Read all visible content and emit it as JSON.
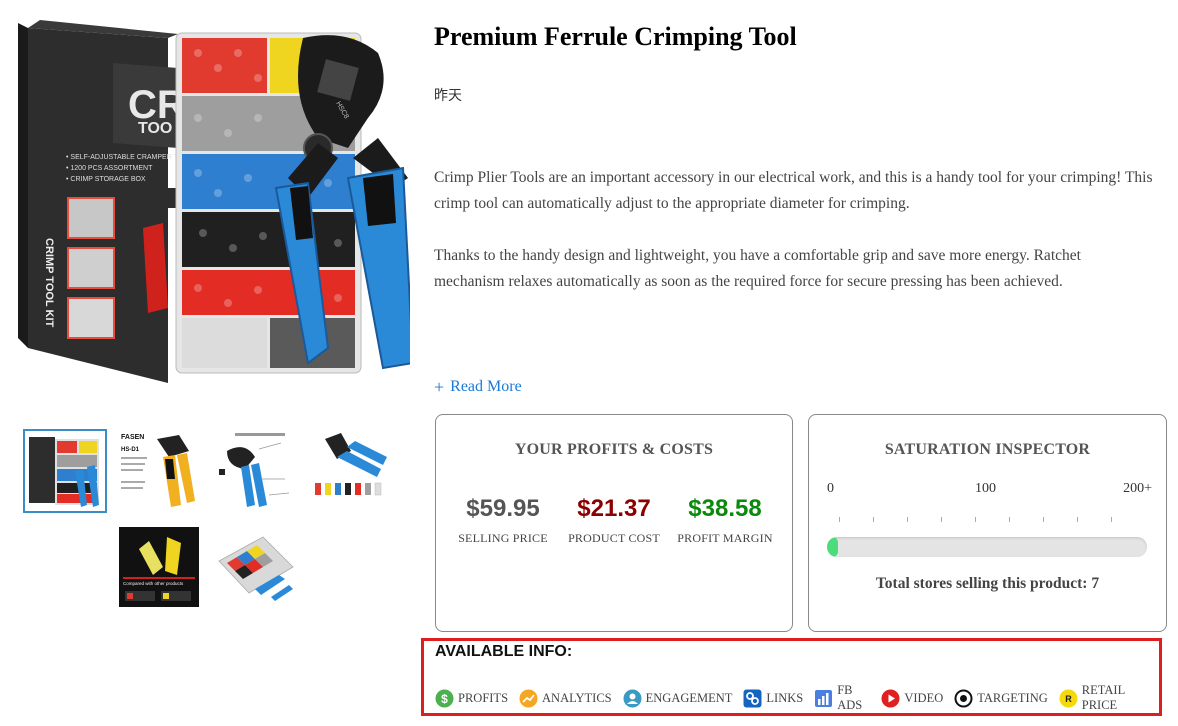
{
  "product": {
    "title": "Premium Ferrule Crimping Tool",
    "date": "昨天",
    "description": [
      "Crimp Plier Tools are an important accessory in our electrical work, and this is a handy tool for your crimping! This crimp tool can automatically adjust to the appropriate diameter for crimping.",
      "Thanks to the handy design and lightweight, you have a comfortable grip and save more energy. Ratchet mechanism relaxes automatically as soon as the required force for secure pressing has been achieved."
    ],
    "read_more": "Read More",
    "main_image": {
      "box_brand": "CRI",
      "box_brand2": "TOO",
      "box_side": "CRIMP TOOL KIT",
      "box_features": [
        "• SELF-ADJUSTABLE CRAMPER TOOL",
        "• 1200 PCS ASSORTMENT",
        "• CRIMP STORAGE BOX"
      ],
      "tool_label": "HSC8"
    },
    "thumbnails": [
      {
        "name": "kit-box-thumbnail",
        "text": ""
      },
      {
        "name": "wire-stripper-thumbnail",
        "text": "FASEN",
        "text2": "HS-D1"
      },
      {
        "name": "crimper-diagram-thumbnail",
        "text": ""
      },
      {
        "name": "ferrule-colors-thumbnail",
        "text": ""
      },
      {
        "name": "wire-connector-thumbnail",
        "text": "Compared with other products"
      },
      {
        "name": "ferrule-box-thumbnail",
        "text": ""
      }
    ]
  },
  "profits": {
    "title": "YOUR PROFITS & COSTS",
    "selling_price": {
      "value": "$59.95",
      "label": "SELLING PRICE",
      "color": "#555555"
    },
    "product_cost": {
      "value": "$21.37",
      "label": "PRODUCT COST",
      "color": "#8b0000"
    },
    "profit_margin": {
      "value": "$38.58",
      "label": "PROFIT MARGIN",
      "color": "#0a8a0a"
    }
  },
  "saturation": {
    "title": "SATURATION INSPECTOR",
    "scale": [
      "0",
      "100",
      "200+"
    ],
    "fill_fraction": 0.035,
    "fill_color": "#4cdc7c",
    "stores_text": "Total stores selling this product: 7"
  },
  "available_info": {
    "title": "AVAILABLE INFO:",
    "items": [
      {
        "label": "PROFITS",
        "icon": "dollar-icon",
        "color": "#4caf50"
      },
      {
        "label": "ANALYTICS",
        "icon": "analytics-icon",
        "color": "#f5a623"
      },
      {
        "label": "ENGAGEMENT",
        "icon": "engagement-icon",
        "color": "#3b9ac4"
      },
      {
        "label": "LINKS",
        "icon": "links-icon",
        "color": "#1565c0"
      },
      {
        "label": "FB ADS",
        "icon": "fb-ads-icon",
        "color": "#4a7ee0"
      },
      {
        "label": "VIDEO",
        "icon": "video-icon",
        "color": "#e02020"
      },
      {
        "label": "TARGETING",
        "icon": "targeting-icon",
        "color": "#111111"
      },
      {
        "label": "RETAIL PRICE",
        "icon": "retail-price-icon",
        "color": "#f5d90a"
      }
    ]
  }
}
